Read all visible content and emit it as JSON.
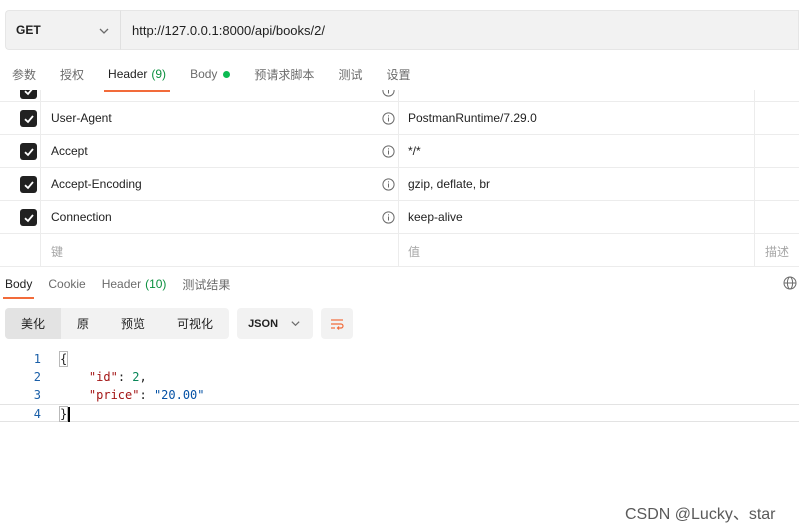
{
  "request": {
    "method": "GET",
    "url": "http://127.0.0.1:8000/api/books/2/"
  },
  "request_tabs": [
    {
      "label": "参数"
    },
    {
      "label": "授权"
    },
    {
      "label": "Header",
      "count": "(9)"
    },
    {
      "label": "Body"
    },
    {
      "label": "预请求脚本"
    },
    {
      "label": "测试"
    },
    {
      "label": "设置"
    }
  ],
  "headers": {
    "rows": [
      {
        "key": "User-Agent",
        "value": "PostmanRuntime/7.29.0"
      },
      {
        "key": "Accept",
        "value": "*/*"
      },
      {
        "key": "Accept-Encoding",
        "value": "gzip, deflate, br"
      },
      {
        "key": "Connection",
        "value": "keep-alive"
      }
    ],
    "placeholder": {
      "key": "键",
      "value": "值",
      "description": "描述"
    }
  },
  "response_tabs": [
    {
      "label": "Body"
    },
    {
      "label": "Cookie"
    },
    {
      "label": "Header",
      "count": "(10)"
    },
    {
      "label": "测试结果"
    }
  ],
  "viewer": {
    "modes": [
      "美化",
      "原",
      "预览",
      "可视化"
    ],
    "format": "JSON"
  },
  "code": {
    "line_numbers": [
      "1",
      "2",
      "3",
      "4"
    ],
    "open_brace": "{",
    "close_brace": "}",
    "id_key": "\"id\"",
    "id_value": "2",
    "price_key": "\"price\"",
    "price_value": "\"20.00\""
  },
  "watermark": "CSDN @Lucky、star",
  "colors": {
    "accent": "#f26b3a",
    "success": "#0cbb52",
    "count_green": "#0a8f3e"
  }
}
